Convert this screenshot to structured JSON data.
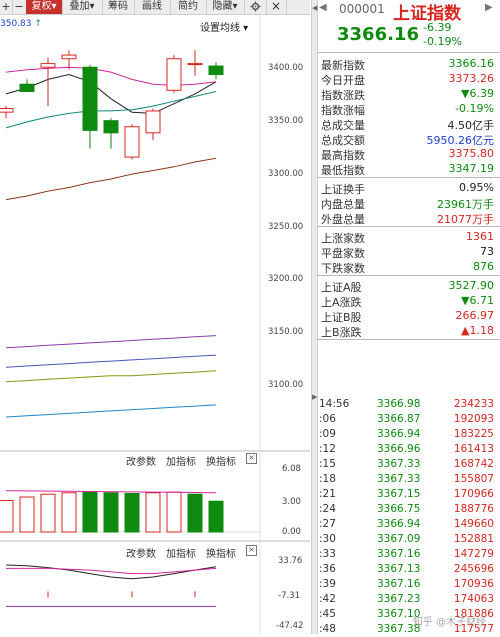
{
  "toolbar": {
    "add_icon": "+",
    "minus_icon": "−",
    "fuquan": "复权",
    "diejia": "叠加",
    "chouma": "筹码",
    "huaxian": "画线",
    "jianyue": "简约",
    "yincang": "隐藏",
    "settings_icon": "gear-icon",
    "close_icon": "×"
  },
  "chart": {
    "ma_value": "350.83",
    "ma_arrow": "↑",
    "settings_link": "设置均线",
    "price_axis": [
      "3400.00",
      "3350.00",
      "3300.00",
      "3250.00",
      "3200.00",
      "3150.00",
      "3100.00"
    ],
    "macd_panel": {
      "param": "改参数",
      "add_indicator": "加指标",
      "switch_indicator": "换指标",
      "close": "×",
      "axis": [
        "6.08",
        "3.00",
        "0.00"
      ]
    },
    "kdj_panel": {
      "param": "改参数",
      "add_indicator": "加指标",
      "switch_indicator": "换指标",
      "close": "×",
      "axis": [
        "33.76",
        "-7.31",
        "-47.42"
      ]
    }
  },
  "chart_data": {
    "type": "candlestick",
    "ylim": [
      3070,
      3415
    ],
    "candles": [
      {
        "o": 3335,
        "h": 3340,
        "l": 3330,
        "c": 3338
      },
      {
        "o": 3358,
        "h": 3362,
        "l": 3352,
        "c": 3352
      },
      {
        "o": 3372,
        "h": 3380,
        "l": 3340,
        "c": 3375
      },
      {
        "o": 3379,
        "h": 3386,
        "l": 3370,
        "c": 3382
      },
      {
        "o": 3372,
        "h": 3374,
        "l": 3305,
        "c": 3320
      },
      {
        "o": 3328,
        "h": 3330,
        "l": 3305,
        "c": 3318
      },
      {
        "o": 3298,
        "h": 3325,
        "l": 3296,
        "c": 3323
      },
      {
        "o": 3318,
        "h": 3338,
        "l": 3312,
        "c": 3336
      },
      {
        "o": 3353,
        "h": 3382,
        "l": 3351,
        "c": 3379
      },
      {
        "o": 3375,
        "h": 3386,
        "l": 3365,
        "c": 3375
      },
      {
        "o": 3373,
        "h": 3376,
        "l": 3362,
        "c": 3366
      }
    ],
    "ma_lines": [
      {
        "color": "#222222",
        "values": [
          3350,
          3355,
          3362,
          3366,
          3360,
          3346,
          3335,
          3334,
          3342,
          3350,
          3360
        ]
      },
      {
        "color": "#d6249c",
        "values": [
          3368,
          3370,
          3371,
          3372,
          3371,
          3368,
          3362,
          3358,
          3357,
          3358,
          3360
        ]
      },
      {
        "color": "#0a8a7a",
        "values": [
          3322,
          3327,
          3331,
          3334,
          3336,
          3336,
          3337,
          3340,
          3344,
          3348,
          3352
        ]
      },
      {
        "color": "#8a3a1a",
        "values": [
          3263,
          3266,
          3270,
          3273,
          3277,
          3280,
          3284,
          3287,
          3290,
          3294,
          3297
        ]
      },
      {
        "color": "#8a3aa8",
        "values": [
          3141,
          3142,
          3143,
          3144,
          3145,
          3146,
          3147,
          3148,
          3149,
          3150,
          3151
        ]
      },
      {
        "color": "#4a55c0",
        "values": [
          3125,
          3126,
          3127,
          3128,
          3129,
          3130,
          3131,
          3132,
          3133,
          3134,
          3135
        ]
      },
      {
        "color": "#7aa010",
        "values": [
          3113,
          3114,
          3115,
          3116,
          3117,
          3118,
          3118,
          3119,
          3120,
          3121,
          3122
        ]
      },
      {
        "color": "#1e87c8",
        "values": [
          3084,
          3085,
          3086,
          3087,
          3088,
          3089,
          3090,
          3091,
          3092,
          3093,
          3094
        ]
      }
    ],
    "macd_bars": [
      {
        "v": 4.5,
        "up": true
      },
      {
        "v": 5.0,
        "up": true
      },
      {
        "v": 5.4,
        "up": true
      },
      {
        "v": 5.6,
        "up": true
      },
      {
        "v": 5.7,
        "up": false
      },
      {
        "v": 5.6,
        "up": false
      },
      {
        "v": 5.5,
        "up": false
      },
      {
        "v": 5.6,
        "up": true
      },
      {
        "v": 5.7,
        "up": true
      },
      {
        "v": 5.4,
        "up": false
      },
      {
        "v": 4.4,
        "up": false
      }
    ],
    "kdj_lines": [
      {
        "color": "#222222",
        "values": [
          28,
          27,
          25,
          22,
          18,
          14,
          12,
          14,
          18,
          22,
          26
        ]
      },
      {
        "color": "#d6249c",
        "values": [
          24,
          24,
          24,
          23,
          22,
          20,
          18,
          18,
          20,
          22,
          24
        ]
      },
      {
        "color": "#8a3aa8",
        "values": [
          -20,
          -20,
          -20,
          -20,
          -20,
          -20,
          -20,
          -20,
          -20,
          -20,
          -20
        ]
      }
    ]
  },
  "quote": {
    "code": "000001",
    "name": "上证指数",
    "last": "3366.16",
    "change": "-6.39",
    "change_pct": "-0.19%",
    "rows_1": [
      {
        "k": "最新指数",
        "v": "3366.16",
        "c": "green"
      },
      {
        "k": "今日开盘",
        "v": "3373.26",
        "c": "red"
      },
      {
        "k": "指数涨跌",
        "v": "▼6.39",
        "c": "green"
      },
      {
        "k": "指数涨幅",
        "v": "-0.19%",
        "c": "green"
      },
      {
        "k": "总成交量",
        "v": "4.50亿手",
        "c": "dark"
      },
      {
        "k": "总成交额",
        "v": "5950.26亿元",
        "c": "blue"
      },
      {
        "k": "最高指数",
        "v": "3375.80",
        "c": "red"
      },
      {
        "k": "最低指数",
        "v": "3347.19",
        "c": "green"
      }
    ],
    "rows_2": [
      {
        "k": "上证换手",
        "v": "0.95%",
        "c": "dark"
      },
      {
        "k": "内盘总量",
        "v": "23961万手",
        "c": "green"
      },
      {
        "k": "外盘总量",
        "v": "21077万手",
        "c": "red"
      }
    ],
    "rows_3": [
      {
        "k": "上涨家数",
        "v": "1361",
        "c": "red"
      },
      {
        "k": "平盘家数",
        "v": "73",
        "c": "dark"
      },
      {
        "k": "下跌家数",
        "v": "876",
        "c": "green"
      }
    ],
    "rows_4": [
      {
        "k": "上证A股",
        "v": "3527.90",
        "c": "green"
      },
      {
        "k": "上A涨跌",
        "v": "▼6.71",
        "c": "green"
      },
      {
        "k": "上证B股",
        "v": "266.97",
        "c": "red"
      },
      {
        "k": "上B涨跌",
        "v": "▲1.18",
        "c": "red"
      }
    ],
    "ticks": [
      {
        "t": "14:56",
        "p": "3366.98",
        "v": "234233"
      },
      {
        "t": ":06",
        "p": "3366.87",
        "v": "192093"
      },
      {
        "t": ":09",
        "p": "3366.94",
        "v": "183225"
      },
      {
        "t": ":12",
        "p": "3366.96",
        "v": "161413"
      },
      {
        "t": ":15",
        "p": "3367.33",
        "v": "168742"
      },
      {
        "t": ":18",
        "p": "3367.33",
        "v": "155807"
      },
      {
        "t": ":21",
        "p": "3367.15",
        "v": "170966"
      },
      {
        "t": ":24",
        "p": "3366.75",
        "v": "188776"
      },
      {
        "t": ":27",
        "p": "3366.94",
        "v": "149660"
      },
      {
        "t": ":30",
        "p": "3367.09",
        "v": "152881"
      },
      {
        "t": ":33",
        "p": "3367.16",
        "v": "147279"
      },
      {
        "t": ":36",
        "p": "3367.13",
        "v": "245696"
      },
      {
        "t": ":39",
        "p": "3367.16",
        "v": "170936"
      },
      {
        "t": ":42",
        "p": "3367.23",
        "v": "174063"
      },
      {
        "t": ":45",
        "p": "3367.10",
        "v": "181886"
      },
      {
        "t": ":48",
        "p": "3367.38",
        "v": "117577"
      }
    ],
    "watermark": "知乎 @木子财经"
  },
  "colors": {
    "up": "#d8261f",
    "down": "#0e8a0e",
    "accent": "#c7312b"
  }
}
